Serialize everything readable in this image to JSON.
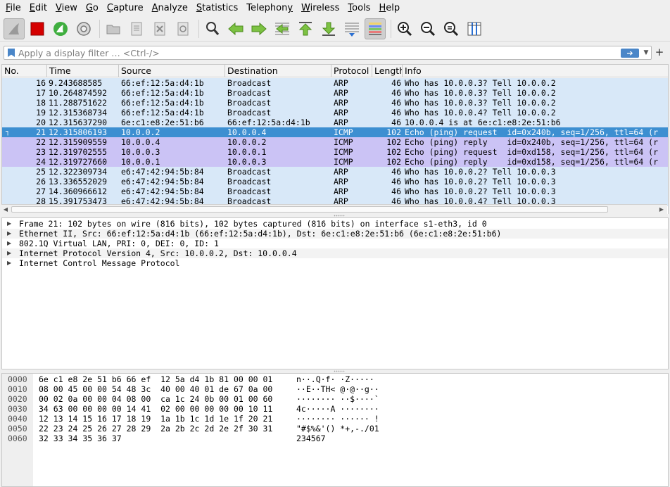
{
  "menu": [
    {
      "u": "F",
      "rest": "ile"
    },
    {
      "u": "E",
      "rest": "dit"
    },
    {
      "u": "V",
      "rest": "iew"
    },
    {
      "u": "G",
      "rest": "o"
    },
    {
      "u": "C",
      "rest": "apture"
    },
    {
      "u": "A",
      "rest": "nalyze"
    },
    {
      "u": "S",
      "rest": "tatistics"
    },
    {
      "u": "",
      "pre": "Telephon",
      "u2": "y",
      "rest": ""
    },
    {
      "u": "W",
      "rest": "ireless"
    },
    {
      "u": "T",
      "rest": "ools"
    },
    {
      "u": "H",
      "rest": "elp"
    }
  ],
  "filter": {
    "placeholder": "Apply a display filter … <Ctrl-/>",
    "value": ""
  },
  "columns": {
    "no": "No.",
    "time": "Time",
    "source": "Source",
    "destination": "Destination",
    "protocol": "Protocol",
    "length": "Length",
    "info": "Info"
  },
  "packets": [
    {
      "no": "16",
      "time": "9.243688585",
      "src": "66:ef:12:5a:d4:1b",
      "dst": "Broadcast",
      "proto": "ARP",
      "len": "46",
      "info": "Who has 10.0.0.3? Tell 10.0.0.2",
      "bg": "#d8e8f8"
    },
    {
      "no": "17",
      "time": "10.264874592",
      "src": "66:ef:12:5a:d4:1b",
      "dst": "Broadcast",
      "proto": "ARP",
      "len": "46",
      "info": "Who has 10.0.0.3? Tell 10.0.0.2",
      "bg": "#d8e8f8"
    },
    {
      "no": "18",
      "time": "11.288751622",
      "src": "66:ef:12:5a:d4:1b",
      "dst": "Broadcast",
      "proto": "ARP",
      "len": "46",
      "info": "Who has 10.0.0.3? Tell 10.0.0.2",
      "bg": "#d8e8f8"
    },
    {
      "no": "19",
      "time": "12.315368734",
      "src": "66:ef:12:5a:d4:1b",
      "dst": "Broadcast",
      "proto": "ARP",
      "len": "46",
      "info": "Who has 10.0.0.4? Tell 10.0.0.2",
      "bg": "#d8e8f8"
    },
    {
      "no": "20",
      "time": "12.315637290",
      "src": "6e:c1:e8:2e:51:b6",
      "dst": "66:ef:12:5a:d4:1b",
      "proto": "ARP",
      "len": "46",
      "info": "10.0.0.4 is at 6e:c1:e8:2e:51:b6",
      "bg": "#d8e8f8"
    },
    {
      "no": "21",
      "time": "12.315806193",
      "src": "10.0.0.2",
      "dst": "10.0.0.4",
      "proto": "ICMP",
      "len": "102",
      "info": "Echo (ping) request  id=0x240b, seq=1/256, ttl=64 (r",
      "bg": "#3d8fd1",
      "selected": true
    },
    {
      "no": "22",
      "time": "12.315909559",
      "src": "10.0.0.4",
      "dst": "10.0.0.2",
      "proto": "ICMP",
      "len": "102",
      "info": "Echo (ping) reply    id=0x240b, seq=1/256, ttl=64 (r",
      "bg": "#cbc3f5"
    },
    {
      "no": "23",
      "time": "12.319702555",
      "src": "10.0.0.3",
      "dst": "10.0.0.1",
      "proto": "ICMP",
      "len": "102",
      "info": "Echo (ping) request  id=0xd158, seq=1/256, ttl=64 (r",
      "bg": "#cbc3f5"
    },
    {
      "no": "24",
      "time": "12.319727660",
      "src": "10.0.0.1",
      "dst": "10.0.0.3",
      "proto": "ICMP",
      "len": "102",
      "info": "Echo (ping) reply    id=0xd158, seq=1/256, ttl=64 (r",
      "bg": "#cbc3f5"
    },
    {
      "no": "25",
      "time": "12.322309734",
      "src": "e6:47:42:94:5b:84",
      "dst": "Broadcast",
      "proto": "ARP",
      "len": "46",
      "info": "Who has 10.0.0.2? Tell 10.0.0.3",
      "bg": "#d8e8f8"
    },
    {
      "no": "26",
      "time": "13.336552029",
      "src": "e6:47:42:94:5b:84",
      "dst": "Broadcast",
      "proto": "ARP",
      "len": "46",
      "info": "Who has 10.0.0.2? Tell 10.0.0.3",
      "bg": "#d8e8f8"
    },
    {
      "no": "27",
      "time": "14.360966612",
      "src": "e6:47:42:94:5b:84",
      "dst": "Broadcast",
      "proto": "ARP",
      "len": "46",
      "info": "Who has 10.0.0.2? Tell 10.0.0.3",
      "bg": "#d8e8f8"
    },
    {
      "no": "28",
      "time": "15.391753473",
      "src": "e6:47:42:94:5b:84",
      "dst": "Broadcast",
      "proto": "ARP",
      "len": "46",
      "info": "Who has 10.0.0.4? Tell 10.0.0.3",
      "bg": "#d8e8f8"
    }
  ],
  "details": [
    "Frame 21: 102 bytes on wire (816 bits), 102 bytes captured (816 bits) on interface s1-eth3, id 0",
    "Ethernet II, Src: 66:ef:12:5a:d4:1b (66:ef:12:5a:d4:1b), Dst: 6e:c1:e8:2e:51:b6 (6e:c1:e8:2e:51:b6)",
    "802.1Q Virtual LAN, PRI: 0, DEI: 0, ID: 1",
    "Internet Protocol Version 4, Src: 10.0.0.2, Dst: 10.0.0.4",
    "Internet Control Message Protocol"
  ],
  "bytes": [
    {
      "offset": "0000",
      "hex": "6e c1 e8 2e 51 b6 66 ef  12 5a d4 1b 81 00 00 01",
      "ascii": "n··.Q·f· ·Z·····"
    },
    {
      "offset": "0010",
      "hex": "08 00 45 00 00 54 48 3c  40 00 40 01 de 67 0a 00",
      "ascii": "··E··TH< @·@··g··"
    },
    {
      "offset": "0020",
      "hex": "00 02 0a 00 00 04 08 00  ca 1c 24 0b 00 01 00 60",
      "ascii": "········ ··$····`"
    },
    {
      "offset": "0030",
      "hex": "34 63 00 00 00 00 14 41  02 00 00 00 00 00 10 11",
      "ascii": "4c·····A ········"
    },
    {
      "offset": "0040",
      "hex": "12 13 14 15 16 17 18 19  1a 1b 1c 1d 1e 1f 20 21",
      "ascii": "········ ······ !"
    },
    {
      "offset": "0050",
      "hex": "22 23 24 25 26 27 28 29  2a 2b 2c 2d 2e 2f 30 31",
      "ascii": "\"#$%&'() *+,-./01"
    },
    {
      "offset": "0060",
      "hex": "32 33 34 35 36 37",
      "ascii": "234567"
    }
  ],
  "colors": {
    "arp_row": "#d8e8f8",
    "icmp_row": "#cbc3f5",
    "selected_row": "#3d8fd1",
    "accent": "#4a86c8"
  }
}
